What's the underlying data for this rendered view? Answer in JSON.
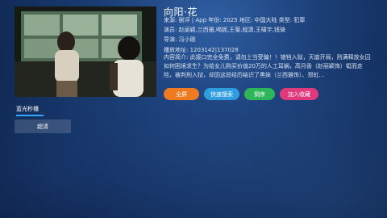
{
  "movie": {
    "title": "向阳·花",
    "source_line": "来源: 剧评 | App  年份: 2025  地区: 中国大陆  类型: 犯罪",
    "cast_line": "演员: 赵丽颖,兰西雅,喝妮,王菊,程潇,王啸宇,钱骑",
    "director_line": "导演: 冯小刚",
    "play_line": "播放地址: 1203142|137028",
    "description": "内容简介: 此接口完全免费，请勿上当受骗！！锒铛入狱，天崩开局，刑满释放女囚如何困境求生？为给女儿购买价值20万的人工耳蜗，高月香（赵丽颖饰）铤而走险，被判刑入狱，却因这段经历结识了黑妹（兰西雅饰）、郑虹..."
  },
  "buttons": {
    "fullscreen": "全屏",
    "quick_search": "快速搜索",
    "reverse_order": "倒序",
    "add_favorite": "加入收藏"
  },
  "sources": {
    "active_tab": "蓝光秒播",
    "episodes": [
      "超清"
    ]
  },
  "colors": {
    "fullscreen": "#f07a1f",
    "quick_search": "#2f9ee0",
    "reverse_order": "#2fb55a",
    "add_favorite": "#e0397c",
    "tab_underline": "#35a7ff"
  }
}
